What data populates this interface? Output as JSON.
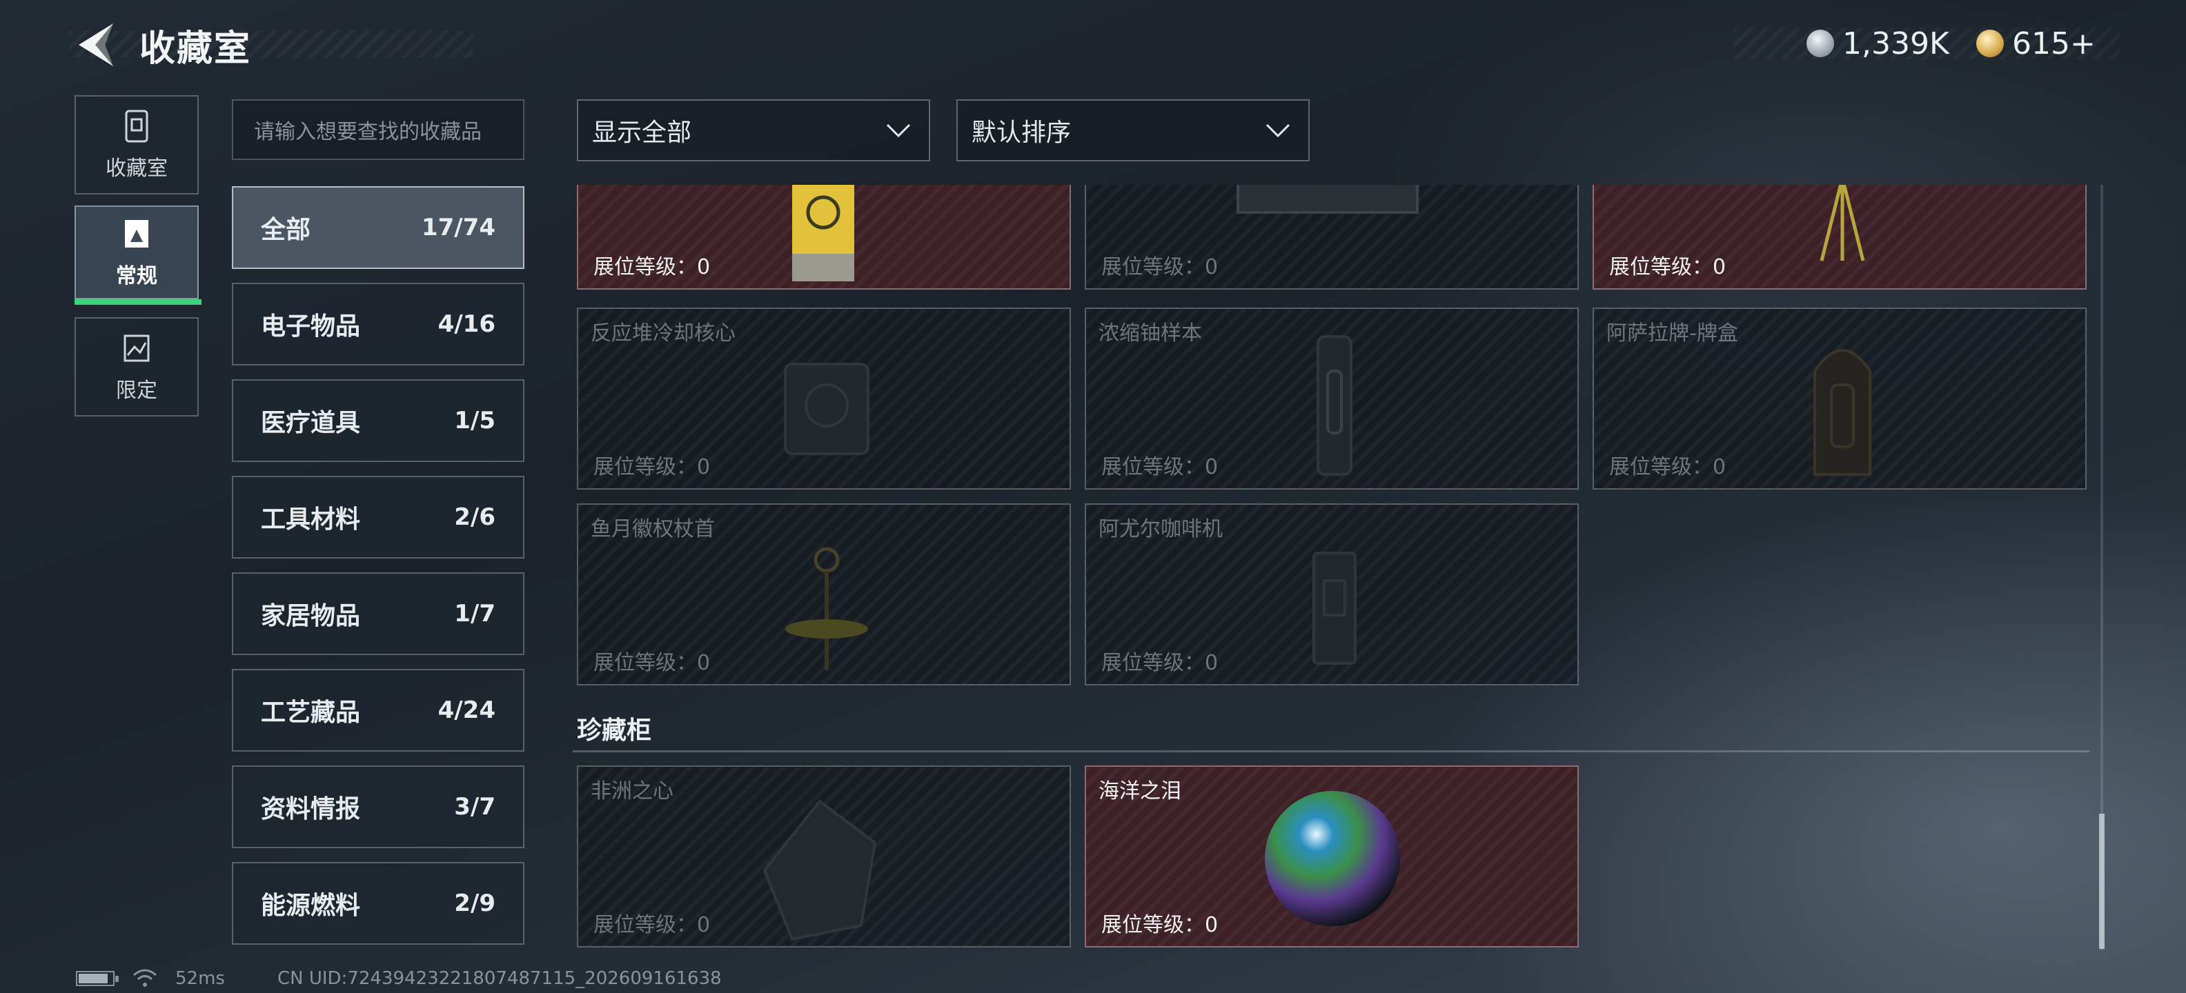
{
  "header": {
    "title": "收藏室",
    "currency": [
      {
        "icon": "silver-coin-icon",
        "value": "1,339K"
      },
      {
        "icon": "gold-coin-icon",
        "value": "615+"
      }
    ]
  },
  "left_nav": [
    {
      "label": "收藏室",
      "icon": "collection-room-icon"
    },
    {
      "label": "常规",
      "icon": "regular-icon",
      "active": true
    },
    {
      "label": "限定",
      "icon": "limited-icon"
    }
  ],
  "search": {
    "placeholder": "请输入想要查找的收藏品"
  },
  "categories": [
    {
      "name": "全部",
      "count": "17/74",
      "active": true
    },
    {
      "name": "电子物品",
      "count": "4/16"
    },
    {
      "name": "医疗道具",
      "count": "1/5"
    },
    {
      "name": "工具材料",
      "count": "2/6"
    },
    {
      "name": "家居物品",
      "count": "1/7"
    },
    {
      "name": "工艺藏品",
      "count": "4/24"
    },
    {
      "name": "资料情报",
      "count": "3/7"
    },
    {
      "name": "能源燃料",
      "count": "2/9"
    }
  ],
  "filters": {
    "display": "显示全部",
    "sort": "默认排序"
  },
  "level_label": "展位等级：0",
  "items_top": [
    {
      "name": "",
      "owned": true,
      "art": "yellow-canister"
    },
    {
      "name": "",
      "owned": false,
      "art": "machine"
    },
    {
      "name": "",
      "owned": true,
      "art": "tripod"
    },
    {
      "name": "反应堆冷却核心",
      "owned": false,
      "art": "reactor-core"
    },
    {
      "name": "浓缩铀样本",
      "owned": false,
      "art": "uranium-capsule"
    },
    {
      "name": "阿萨拉牌-牌盒",
      "owned": false,
      "art": "card-box"
    },
    {
      "name": "鱼月徽权杖首",
      "owned": false,
      "art": "scepter"
    },
    {
      "name": "阿尤尔咖啡机",
      "owned": false,
      "art": "coffee-machine"
    }
  ],
  "section": {
    "title": "珍藏柜"
  },
  "items_cabinet": [
    {
      "name": "非洲之心",
      "owned": false,
      "art": "gem"
    },
    {
      "name": "海洋之泪",
      "owned": true,
      "art": "pearl"
    }
  ],
  "status": {
    "ping": "52ms",
    "uid": "CN UID:7243942322180748711​5_202609161638"
  }
}
